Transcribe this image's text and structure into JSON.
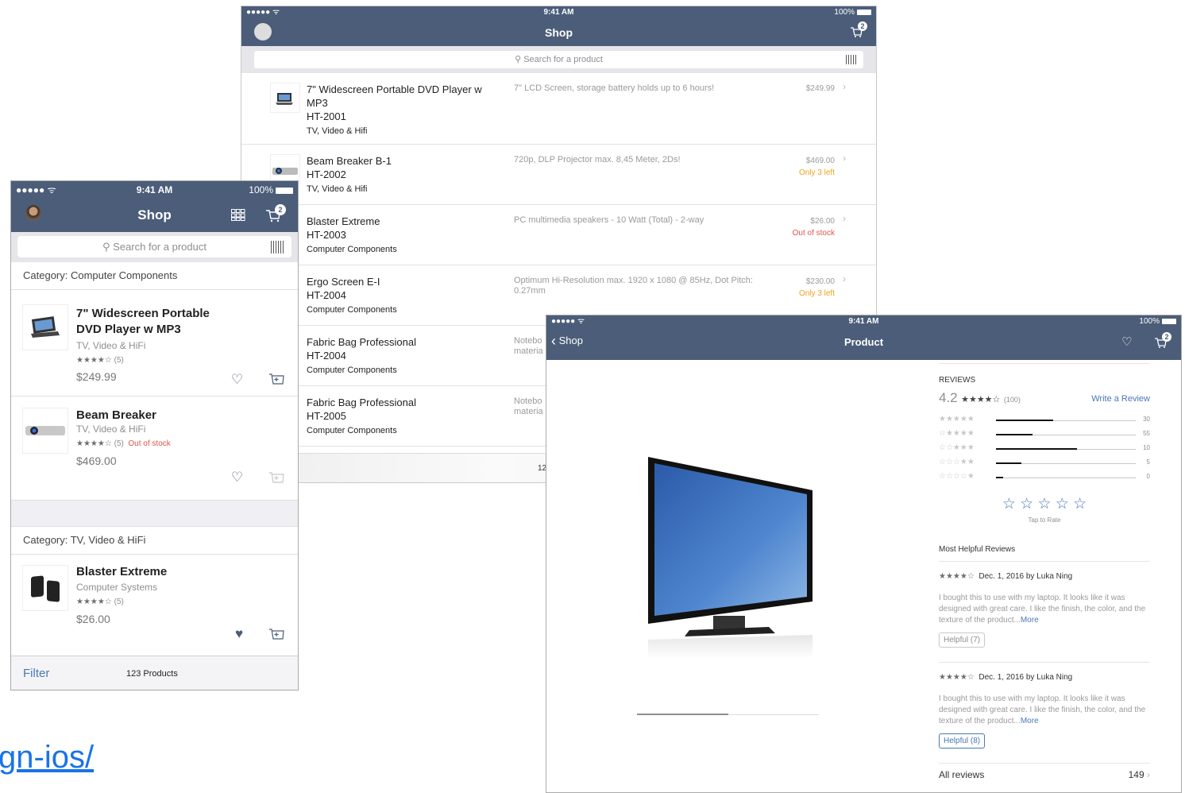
{
  "status": {
    "carrier": "●●●●● ᯤ",
    "time": "9:41 AM",
    "battery": "100%"
  },
  "colors": {
    "navbar": "#4b5d79",
    "accent": "#3c78c4",
    "danger": "#e2544c",
    "warning": "#f2a21c"
  },
  "ipad_shop": {
    "title": "Shop",
    "cart_count": "2",
    "search_placeholder": "Search for a product",
    "rows": [
      {
        "name_lines": [
          "7\" Widescreen Portable DVD Player w",
          "MP3",
          "HT-2001"
        ],
        "category": "TV, Video & Hifi",
        "desc": "7\" LCD Screen, storage battery holds up to 6 hours!",
        "price": "$249.99",
        "stock": ""
      },
      {
        "name_lines": [
          "Beam Breaker B-1",
          "HT-2002"
        ],
        "category": "TV, Video & Hifi",
        "desc": "720p, DLP Projector max. 8,45 Meter, 2Ds!",
        "price": "$469.00",
        "stock": "Only 3 left"
      },
      {
        "name_lines": [
          "Blaster Extreme",
          "HT-2003"
        ],
        "category": "Computer Components",
        "desc": "PC multimedia speakers - 10 Watt (Total) - 2-way",
        "price": "$26.00",
        "stock": "Out of stock"
      },
      {
        "name_lines": [
          "Ergo Screen E-I",
          "HT-2004"
        ],
        "category": "Computer Components",
        "desc": "Optimum Hi-Resolution max. 1920 x 1080 @ 85Hz, Dot Pitch: 0.27mm",
        "price": "$230.00",
        "stock": "Only 3 left"
      },
      {
        "name_lines": [
          "Fabric Bag Professional",
          "HT-2004"
        ],
        "category": "Computer Components",
        "desc": "Notebo materia",
        "price": "",
        "stock": ""
      },
      {
        "name_lines": [
          "Fabric Bag Professional",
          "HT-2005"
        ],
        "category": "Computer Components",
        "desc": "Notebo materia",
        "price": "",
        "stock": ""
      }
    ],
    "footer_count": "12"
  },
  "iphone_shop": {
    "title": "Shop",
    "cart_count": "2",
    "search_placeholder": "Search for a product",
    "category1": "Category: Computer Components",
    "category2": "Category: TV, Video & HiFi",
    "items": [
      {
        "name_lines": [
          "7\" Widescreen Portable",
          "DVD Player w MP3"
        ],
        "sub": "TV, Video & HiFi",
        "rating": "★★★★☆",
        "count": "(5)",
        "stock": "",
        "price": "$249.99",
        "favorite": false
      },
      {
        "name_lines": [
          "Beam Breaker"
        ],
        "sub": "TV, Video & HiFi",
        "rating": "★★★★☆",
        "count": "(5)",
        "stock": "Out of stock",
        "price": "$469.00",
        "favorite": false
      },
      {
        "name_lines": [
          "Blaster Extreme"
        ],
        "sub": "Computer Systems",
        "rating": "★★★★☆",
        "count": "(5)",
        "stock": "",
        "price": "$26.00",
        "favorite": true
      }
    ],
    "filter_label": "Filter",
    "products_count": "123 Products"
  },
  "ipad_product": {
    "back_label": "Shop",
    "title": "Product",
    "cart_count": "2",
    "reviews_heading": "REVIEWS",
    "avg_rating": "4.2",
    "avg_stars": "★★★★☆",
    "review_count": "(100)",
    "write_review": "Write a Review",
    "distribution": [
      {
        "stars": "★★★★★",
        "value": 30,
        "fraction": 0.41
      },
      {
        "stars": "☆★★★★",
        "value": 55,
        "fraction": 0.26
      },
      {
        "stars": "☆☆★★★",
        "value": 10,
        "fraction": 0.58
      },
      {
        "stars": "☆☆☆★★",
        "value": 5,
        "fraction": 0.18
      },
      {
        "stars": "☆☆☆☆★",
        "value": 0,
        "fraction": 0.05
      }
    ],
    "rate_stars": "☆ ☆ ☆ ☆ ☆",
    "tap_to_rate": "Tap to Rate",
    "helpful_heading": "Most Helpful Reviews",
    "reviews": [
      {
        "stars": "★★★★☆",
        "meta": "Dec. 1, 2016 by Luka Ning",
        "text": "I bought this to use with my laptop. It looks like it was designed with great care. I like the finish, the color, and the texture of the product...",
        "more": "More",
        "helpful": "Helpful (7)"
      },
      {
        "stars": "★★★★☆",
        "meta": "Dec. 1, 2016 by Luka Ning",
        "text": "I bought this to use with my laptop. It looks like it was designed with great care. I like the finish, the color, and the texture of the product...",
        "more": "More",
        "helpful": "Helpful (8)"
      }
    ],
    "all_reviews_label": "All reviews",
    "all_reviews_count": "149"
  },
  "link_fragment": "gn-ios/"
}
